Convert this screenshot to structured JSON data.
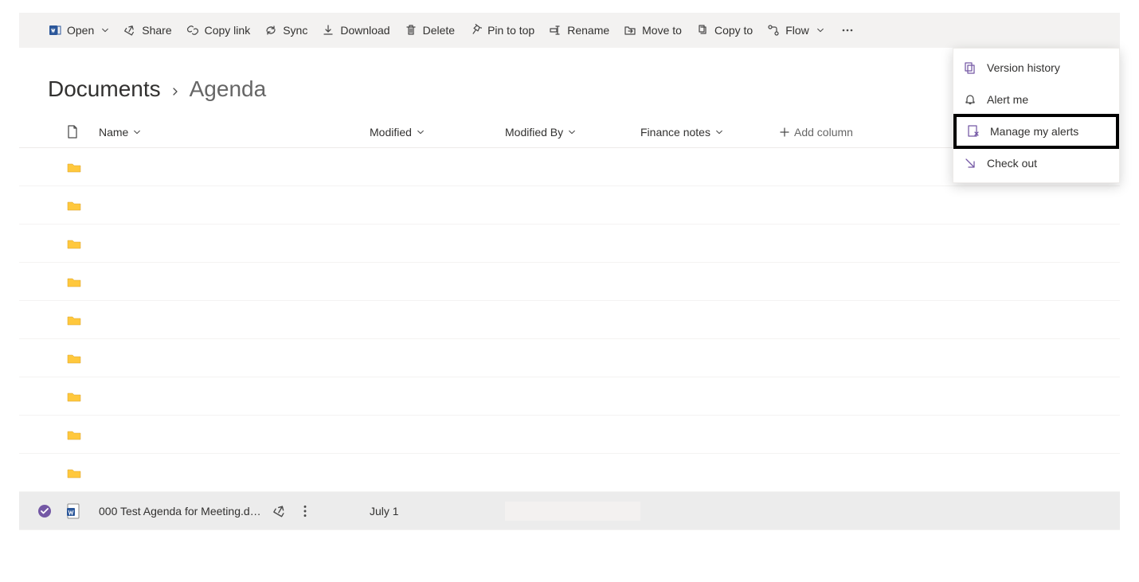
{
  "toolbar": {
    "open": "Open",
    "share": "Share",
    "copyLink": "Copy link",
    "sync": "Sync",
    "download": "Download",
    "delete": "Delete",
    "pin": "Pin to top",
    "rename": "Rename",
    "moveTo": "Move to",
    "copyTo": "Copy to",
    "flow": "Flow"
  },
  "breadcrumb": {
    "root": "Documents",
    "leaf": "Agenda"
  },
  "columns": {
    "name": "Name",
    "modified": "Modified",
    "modifiedBy": "Modified By",
    "finance": "Finance notes",
    "add": "Add column"
  },
  "rows": {
    "doc1": {
      "name": "000 Test Agenda for Meeting.d…",
      "modified": "July 1"
    }
  },
  "contextMenu": {
    "versionHistory": "Version history",
    "alertMe": "Alert me",
    "manageAlerts": "Manage my alerts",
    "checkOut": "Check out"
  }
}
